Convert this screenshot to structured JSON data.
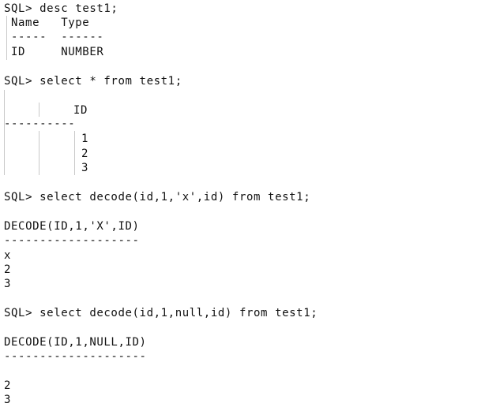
{
  "lines": {
    "cmd_desc": "SQL> desc test1;",
    "desc_header": "Name   Type",
    "desc_sep": "-----  ------",
    "desc_row": "ID     NUMBER",
    "cmd_select": "SQL> select * from test1;",
    "select_header": "ID",
    "select_sep": "----------",
    "select_rows": [
      "1",
      "2",
      "3"
    ],
    "cmd_decode1": "SQL> select decode(id,1,'x',id) from test1;",
    "decode1_header": "DECODE(ID,1,'X',ID)",
    "decode1_sep": "-------------------",
    "decode1_rows": [
      "x",
      "2",
      "3"
    ],
    "cmd_decode2": "SQL> select decode(id,1,null,id) from test1;",
    "decode2_header": "DECODE(ID,1,NULL,ID)",
    "decode2_sep": "--------------------",
    "decode2_rows": [
      "",
      "2",
      "3"
    ]
  }
}
